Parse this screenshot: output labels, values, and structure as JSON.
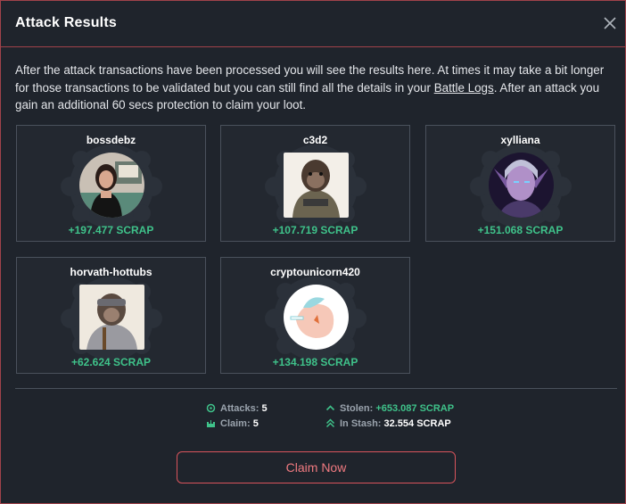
{
  "modal": {
    "title": "Attack Results",
    "description_pre": "After the attack transactions have been processed you will see the results here. At times it may take a bit longer for those transactions to be validated but you can still find all the details in your ",
    "description_link": "Battle Logs",
    "description_post": ". After an attack you gain an additional 60 secs protection to claim your loot."
  },
  "results": [
    {
      "name": "bossdebz",
      "scrap": "+197.477 SCRAP",
      "avatar": "woman-photo-icon"
    },
    {
      "name": "c3d2",
      "scrap": "+107.719 SCRAP",
      "avatar": "ape-hoodie-icon"
    },
    {
      "name": "xylliana",
      "scrap": "+151.068 SCRAP",
      "avatar": "elf-warrior-icon"
    },
    {
      "name": "horvath-hottubs",
      "scrap": "+62.624 SCRAP",
      "avatar": "ape-goggles-icon"
    },
    {
      "name": "cryptounicorn420",
      "scrap": "+134.198 SCRAP",
      "avatar": "unicorn-icon"
    }
  ],
  "summary": {
    "attacks_label": "Attacks:",
    "attacks_value": "5",
    "claim_label": "Claim:",
    "claim_value": "5",
    "stolen_label": "Stolen:",
    "stolen_value": "+653.087 SCRAP",
    "stash_label": "In Stash:",
    "stash_value": "32.554 SCRAP"
  },
  "actions": {
    "claim_label": "Claim Now"
  },
  "colors": {
    "accent_border": "#a0424a",
    "scrap_green": "#3fc28a",
    "claim_red": "#d9545c"
  }
}
